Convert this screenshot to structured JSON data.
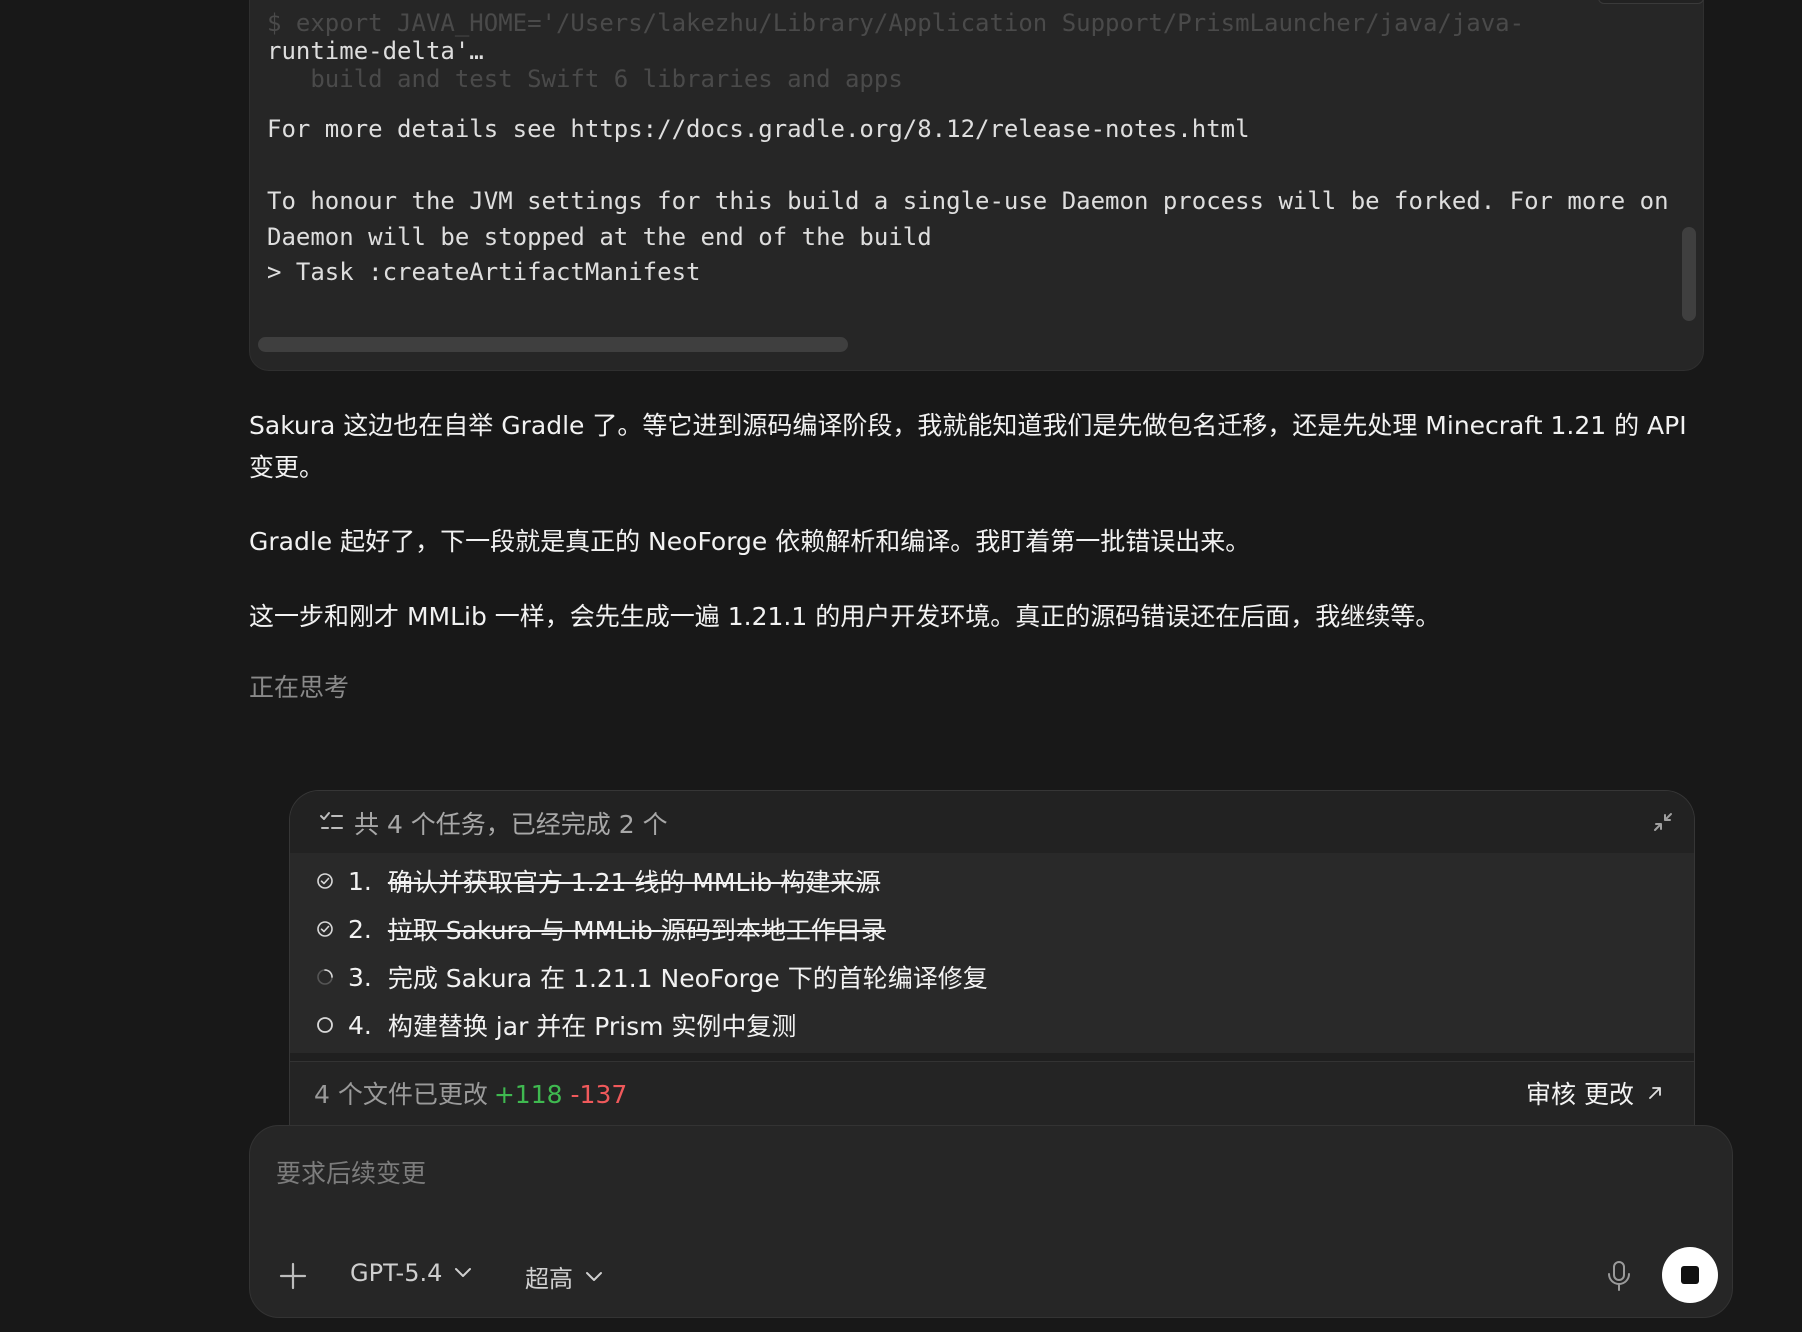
{
  "terminal": {
    "ghost_top": "$ export JAVA_HOME='/Users/lakezhu/Library/Application Support/PrismLauncher/java/java-",
    "line_runtime": "runtime-delta'…",
    "ghost_mid": "   build and test Swift 6 libraries and apps",
    "line_details": "For more details see https://docs.gradle.org/8.12/release-notes.html",
    "line_honour": "To honour the JVM settings for this build a single-use Daemon process will be forked. For more on",
    "line_daemon": "Daemon will be stopped at the end of the build",
    "line_task": "> Task :createArtifactManifest"
  },
  "messages": [
    "Sakura 这边也在自举 Gradle 了。等它进到源码编译阶段，我就能知道我们是先做包名迁移，还是先处理 Minecraft 1.21 的 API 变更。",
    "Gradle 起好了，下一段就是真正的 NeoForge 依赖解析和编译。我盯着第一批错误出来。",
    "这一步和刚才 MMLib 一样，会先生成一遍 1.21.1 的用户开发环境。真正的源码错误还在后面，我继续等。"
  ],
  "thinking_label": "正在思考",
  "tasks": {
    "header": "共 4 个任务，已经完成 2 个",
    "header_icon": "checklist-icon",
    "collapse_icon": "collapse-icon",
    "items": [
      {
        "num": "1.",
        "text": "确认并获取官方 1.21 线的 MMLib 构建来源",
        "status": "done"
      },
      {
        "num": "2.",
        "text": "拉取 Sakura 与 MMLib 源码到本地工作目录",
        "status": "done"
      },
      {
        "num": "3.",
        "text": "完成 Sakura 在 1.21.1 NeoForge 下的首轮编译修复",
        "status": "in-progress"
      },
      {
        "num": "4.",
        "text": "构建替换 jar 并在 Prism 实例中复测",
        "status": "pending"
      }
    ],
    "files_changed": "4 个文件已更改",
    "additions": "+118",
    "deletions": "-137",
    "review_label": "审核 更改",
    "colors": {
      "add": "#3fb950",
      "del": "#f0595b"
    }
  },
  "composer": {
    "placeholder": "要求后续变更",
    "model": "GPT-5.4",
    "effort": "超高",
    "icons": [
      "plus-icon",
      "chevron-down-icon",
      "microphone-icon",
      "stop-icon"
    ]
  }
}
